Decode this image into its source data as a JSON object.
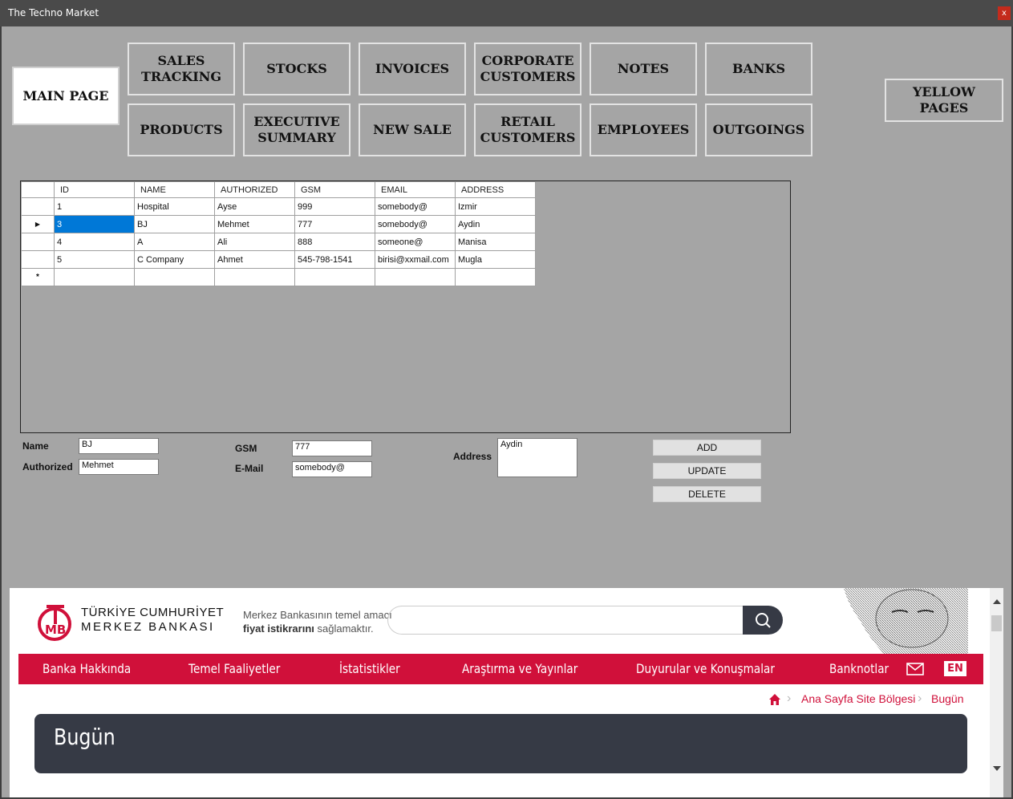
{
  "window": {
    "title": "The Techno Market",
    "close_label": "x"
  },
  "nav": {
    "main_page": "MAIN PAGE",
    "sales_tracking": "SALES\nTRACKING",
    "stocks": "STOCKS",
    "invoices": "INVOICES",
    "corporate_customers": "CORPORATE\nCUSTOMERS",
    "notes": "NOTES",
    "banks": "BANKS",
    "products": "PRODUCTS",
    "executive_summary": "EXECUTIVE\nSUMMARY",
    "new_sale": "NEW SALE",
    "retail_customers": "RETAIL\nCUSTOMERS",
    "employees": "EMPLOYEES",
    "outgoings": "OUTGOINGS",
    "yellow_pages": "YELLOW PAGES"
  },
  "grid": {
    "columns": [
      "ID",
      "NAME",
      "AUTHORIZED",
      "GSM",
      "EMAIL",
      "ADDRESS"
    ],
    "rows": [
      [
        "1",
        "Hospital",
        "Ayse",
        "999",
        "somebody@",
        "Izmir"
      ],
      [
        "3",
        "BJ",
        "Mehmet",
        "777",
        "somebody@",
        "Aydin"
      ],
      [
        "4",
        "A",
        "Ali",
        "888",
        "someone@",
        "Manisa"
      ],
      [
        "5",
        "C Company",
        "Ahmet",
        "545-798-1541",
        "birisi@xxmail.com",
        "Mugla"
      ]
    ],
    "new_row_marker": "*",
    "current_row_marker": "▶"
  },
  "form": {
    "name_label": "Name",
    "name_value": "BJ",
    "authorized_label": "Authorized",
    "authorized_value": "Mehmet",
    "gsm_label": "GSM",
    "gsm_value": "777",
    "email_label": "E-Mail",
    "email_value": "somebody@",
    "address_label": "Address",
    "address_value": "Aydin",
    "add": "ADD",
    "update": "UPDATE",
    "delete": "DELETE"
  },
  "web": {
    "logo_line1": "TÜRKİYE CUMHURİYET",
    "logo_line2": "MERKEZ BANKASI",
    "logo_mark": "TCMB",
    "tagline_1": "Merkez Bankasının temel amacı",
    "tagline_2_bold": "fiyat istikrarını",
    "tagline_2_rest": " sağlamaktır.",
    "menu": [
      "Banka Hakkında",
      "Temel Faaliyetler",
      "İstatistikler",
      "Araştırma ve Yayınlar",
      "Duyurular ve Konuşmalar",
      "Banknotlar"
    ],
    "lang": "EN",
    "crumb_1": "Ana Sayfa Site Bölgesi",
    "crumb_2": "Bugün",
    "heading": "Bugün",
    "accent": "#d0103a",
    "dark": "#363a45"
  }
}
